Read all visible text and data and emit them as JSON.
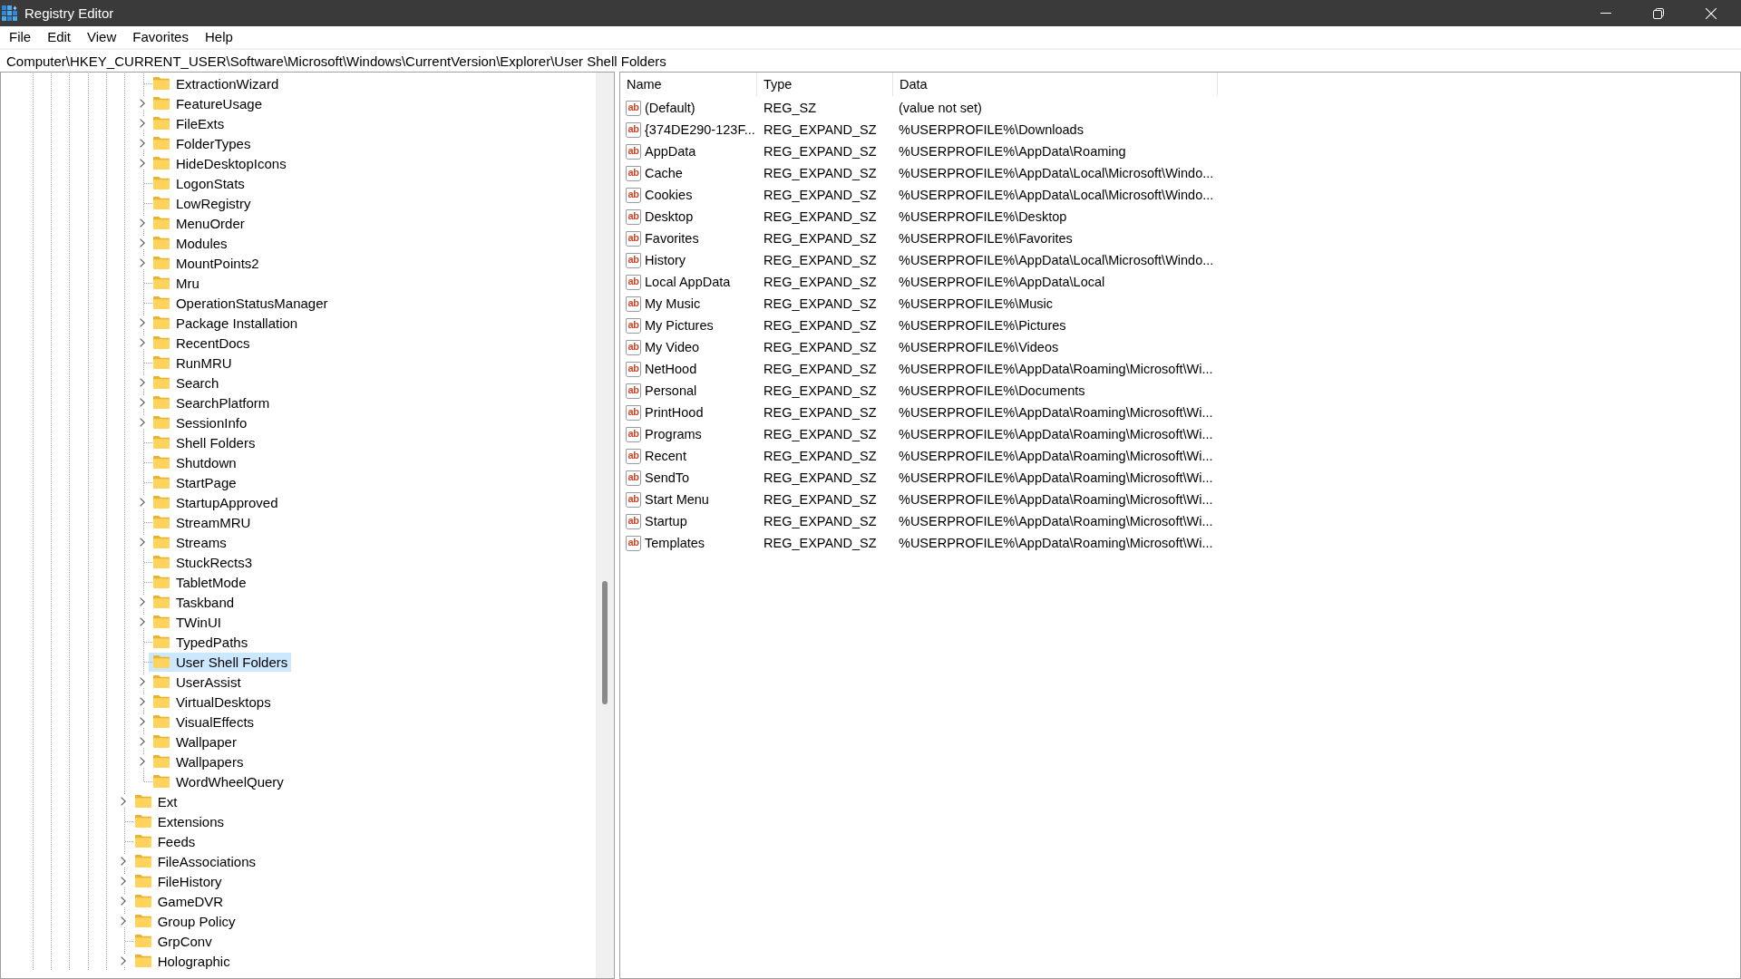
{
  "window": {
    "title": "Registry Editor"
  },
  "menu": [
    "File",
    "Edit",
    "View",
    "Favorites",
    "Help"
  ],
  "address_bar": {
    "value": "Computer\\HKEY_CURRENT_USER\\Software\\Microsoft\\Windows\\CurrentVersion\\Explorer\\User Shell Folders"
  },
  "tree": {
    "items": [
      {
        "children": [
          {
            "label": "ExtractionWizard",
            "has_children": false,
            "selected": false
          },
          {
            "label": "FeatureUsage",
            "has_children": true,
            "selected": false
          },
          {
            "label": "FileExts",
            "has_children": true,
            "selected": false
          },
          {
            "label": "FolderTypes",
            "has_children": true,
            "selected": false
          },
          {
            "label": "HideDesktopIcons",
            "has_children": true,
            "selected": false
          },
          {
            "label": "LogonStats",
            "has_children": false,
            "selected": false
          },
          {
            "label": "LowRegistry",
            "has_children": false,
            "selected": false
          },
          {
            "label": "MenuOrder",
            "has_children": true,
            "selected": false
          },
          {
            "label": "Modules",
            "has_children": true,
            "selected": false
          },
          {
            "label": "MountPoints2",
            "has_children": true,
            "selected": false
          },
          {
            "label": "Mru",
            "has_children": false,
            "selected": false
          },
          {
            "label": "OperationStatusManager",
            "has_children": false,
            "selected": false
          },
          {
            "label": "Package Installation",
            "has_children": true,
            "selected": false
          },
          {
            "label": "RecentDocs",
            "has_children": true,
            "selected": false
          },
          {
            "label": "RunMRU",
            "has_children": false,
            "selected": false
          },
          {
            "label": "Search",
            "has_children": true,
            "selected": false
          },
          {
            "label": "SearchPlatform",
            "has_children": true,
            "selected": false
          },
          {
            "label": "SessionInfo",
            "has_children": true,
            "selected": false
          },
          {
            "label": "Shell Folders",
            "has_children": false,
            "selected": false
          },
          {
            "label": "Shutdown",
            "has_children": false,
            "selected": false
          },
          {
            "label": "StartPage",
            "has_children": false,
            "selected": false
          },
          {
            "label": "StartupApproved",
            "has_children": true,
            "selected": false
          },
          {
            "label": "StreamMRU",
            "has_children": false,
            "selected": false
          },
          {
            "label": "Streams",
            "has_children": true,
            "selected": false
          },
          {
            "label": "StuckRects3",
            "has_children": false,
            "selected": false
          },
          {
            "label": "TabletMode",
            "has_children": false,
            "selected": false
          },
          {
            "label": "Taskband",
            "has_children": true,
            "selected": false
          },
          {
            "label": "TWinUI",
            "has_children": true,
            "selected": false
          },
          {
            "label": "TypedPaths",
            "has_children": false,
            "selected": false
          },
          {
            "label": "User Shell Folders",
            "has_children": false,
            "selected": true
          },
          {
            "label": "UserAssist",
            "has_children": true,
            "selected": false
          },
          {
            "label": "VirtualDesktops",
            "has_children": true,
            "selected": false
          },
          {
            "label": "VisualEffects",
            "has_children": true,
            "selected": false
          },
          {
            "label": "Wallpaper",
            "has_children": true,
            "selected": false
          },
          {
            "label": "Wallpapers",
            "has_children": true,
            "selected": false
          },
          {
            "label": "WordWheelQuery",
            "has_children": false,
            "selected": false
          }
        ]
      },
      {
        "label": "Ext",
        "has_children": true,
        "selected": false
      },
      {
        "label": "Extensions",
        "has_children": false,
        "selected": false
      },
      {
        "label": "Feeds",
        "has_children": false,
        "selected": false
      },
      {
        "label": "FileAssociations",
        "has_children": true,
        "selected": false
      },
      {
        "label": "FileHistory",
        "has_children": true,
        "selected": false
      },
      {
        "label": "GameDVR",
        "has_children": true,
        "selected": false
      },
      {
        "label": "Group Policy",
        "has_children": true,
        "selected": false
      },
      {
        "label": "GrpConv",
        "has_children": false,
        "selected": false
      },
      {
        "label": "Holographic",
        "has_children": true,
        "selected": false
      }
    ]
  },
  "values_table": {
    "columns": [
      "Name",
      "Type",
      "Data"
    ],
    "rows": [
      {
        "icon_text": "ab",
        "name": "(Default)",
        "type": "REG_SZ",
        "data": "(value not set)"
      },
      {
        "icon_text": "ab",
        "name": "{374DE290-123F...",
        "type": "REG_EXPAND_SZ",
        "data": "%USERPROFILE%\\Downloads"
      },
      {
        "icon_text": "ab",
        "name": "AppData",
        "type": "REG_EXPAND_SZ",
        "data": "%USERPROFILE%\\AppData\\Roaming"
      },
      {
        "icon_text": "ab",
        "name": "Cache",
        "type": "REG_EXPAND_SZ",
        "data": "%USERPROFILE%\\AppData\\Local\\Microsoft\\Windo..."
      },
      {
        "icon_text": "ab",
        "name": "Cookies",
        "type": "REG_EXPAND_SZ",
        "data": "%USERPROFILE%\\AppData\\Local\\Microsoft\\Windo..."
      },
      {
        "icon_text": "ab",
        "name": "Desktop",
        "type": "REG_EXPAND_SZ",
        "data": "%USERPROFILE%\\Desktop"
      },
      {
        "icon_text": "ab",
        "name": "Favorites",
        "type": "REG_EXPAND_SZ",
        "data": "%USERPROFILE%\\Favorites"
      },
      {
        "icon_text": "ab",
        "name": "History",
        "type": "REG_EXPAND_SZ",
        "data": "%USERPROFILE%\\AppData\\Local\\Microsoft\\Windo..."
      },
      {
        "icon_text": "ab",
        "name": "Local AppData",
        "type": "REG_EXPAND_SZ",
        "data": "%USERPROFILE%\\AppData\\Local"
      },
      {
        "icon_text": "ab",
        "name": "My Music",
        "type": "REG_EXPAND_SZ",
        "data": "%USERPROFILE%\\Music"
      },
      {
        "icon_text": "ab",
        "name": "My Pictures",
        "type": "REG_EXPAND_SZ",
        "data": "%USERPROFILE%\\Pictures"
      },
      {
        "icon_text": "ab",
        "name": "My Video",
        "type": "REG_EXPAND_SZ",
        "data": "%USERPROFILE%\\Videos"
      },
      {
        "icon_text": "ab",
        "name": "NetHood",
        "type": "REG_EXPAND_SZ",
        "data": "%USERPROFILE%\\AppData\\Roaming\\Microsoft\\Wi..."
      },
      {
        "icon_text": "ab",
        "name": "Personal",
        "type": "REG_EXPAND_SZ",
        "data": "%USERPROFILE%\\Documents"
      },
      {
        "icon_text": "ab",
        "name": "PrintHood",
        "type": "REG_EXPAND_SZ",
        "data": "%USERPROFILE%\\AppData\\Roaming\\Microsoft\\Wi..."
      },
      {
        "icon_text": "ab",
        "name": "Programs",
        "type": "REG_EXPAND_SZ",
        "data": "%USERPROFILE%\\AppData\\Roaming\\Microsoft\\Wi..."
      },
      {
        "icon_text": "ab",
        "name": "Recent",
        "type": "REG_EXPAND_SZ",
        "data": "%USERPROFILE%\\AppData\\Roaming\\Microsoft\\Wi..."
      },
      {
        "icon_text": "ab",
        "name": "SendTo",
        "type": "REG_EXPAND_SZ",
        "data": "%USERPROFILE%\\AppData\\Roaming\\Microsoft\\Wi..."
      },
      {
        "icon_text": "ab",
        "name": "Start Menu",
        "type": "REG_EXPAND_SZ",
        "data": "%USERPROFILE%\\AppData\\Roaming\\Microsoft\\Wi..."
      },
      {
        "icon_text": "ab",
        "name": "Startup",
        "type": "REG_EXPAND_SZ",
        "data": "%USERPROFILE%\\AppData\\Roaming\\Microsoft\\Wi..."
      },
      {
        "icon_text": "ab",
        "name": "Templates",
        "type": "REG_EXPAND_SZ",
        "data": "%USERPROFILE%\\AppData\\Roaming\\Microsoft\\Wi..."
      }
    ]
  }
}
